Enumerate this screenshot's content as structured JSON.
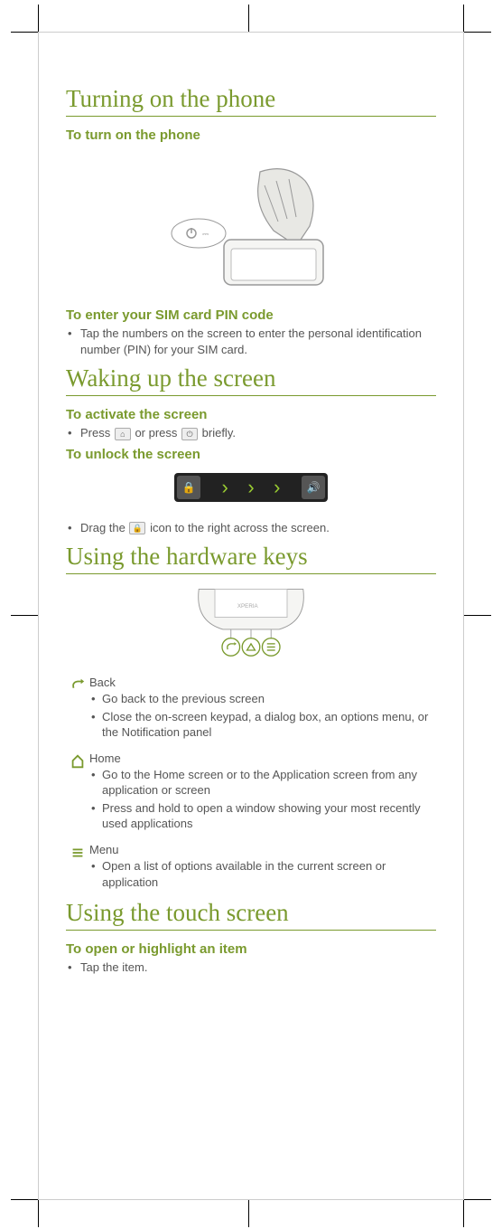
{
  "sections": {
    "turning_on": {
      "heading": "Turning on the phone",
      "sub1": "To turn on the phone",
      "sub2": "To enter your SIM card PIN code",
      "bullet2": "Tap the numbers on the screen to enter the personal identification number (PIN) for your SIM card."
    },
    "waking": {
      "heading": "Waking up the screen",
      "sub1": "To activate the screen",
      "bullet1_a": "Press ",
      "bullet1_b": " or press ",
      "bullet1_c": " briefly.",
      "sub2": "To unlock the screen",
      "bullet2_a": "Drag the ",
      "bullet2_b": " icon to the right across the screen."
    },
    "hardware": {
      "heading": "Using the hardware keys",
      "keys": [
        {
          "name": "Back",
          "bullets": [
            "Go back to the previous screen",
            "Close the on-screen keypad, a dialog box, an options menu, or the Notification panel"
          ]
        },
        {
          "name": "Home",
          "bullets": [
            "Go to the Home screen or to the Application screen from any application or screen",
            "Press and hold to open a window showing your most recently used applications"
          ]
        },
        {
          "name": "Menu",
          "bullets": [
            "Open a list of options available in the current screen or application"
          ]
        }
      ]
    },
    "touch": {
      "heading": "Using the touch screen",
      "sub1": "To open or highlight an item",
      "bullet1": "Tap the item."
    }
  }
}
